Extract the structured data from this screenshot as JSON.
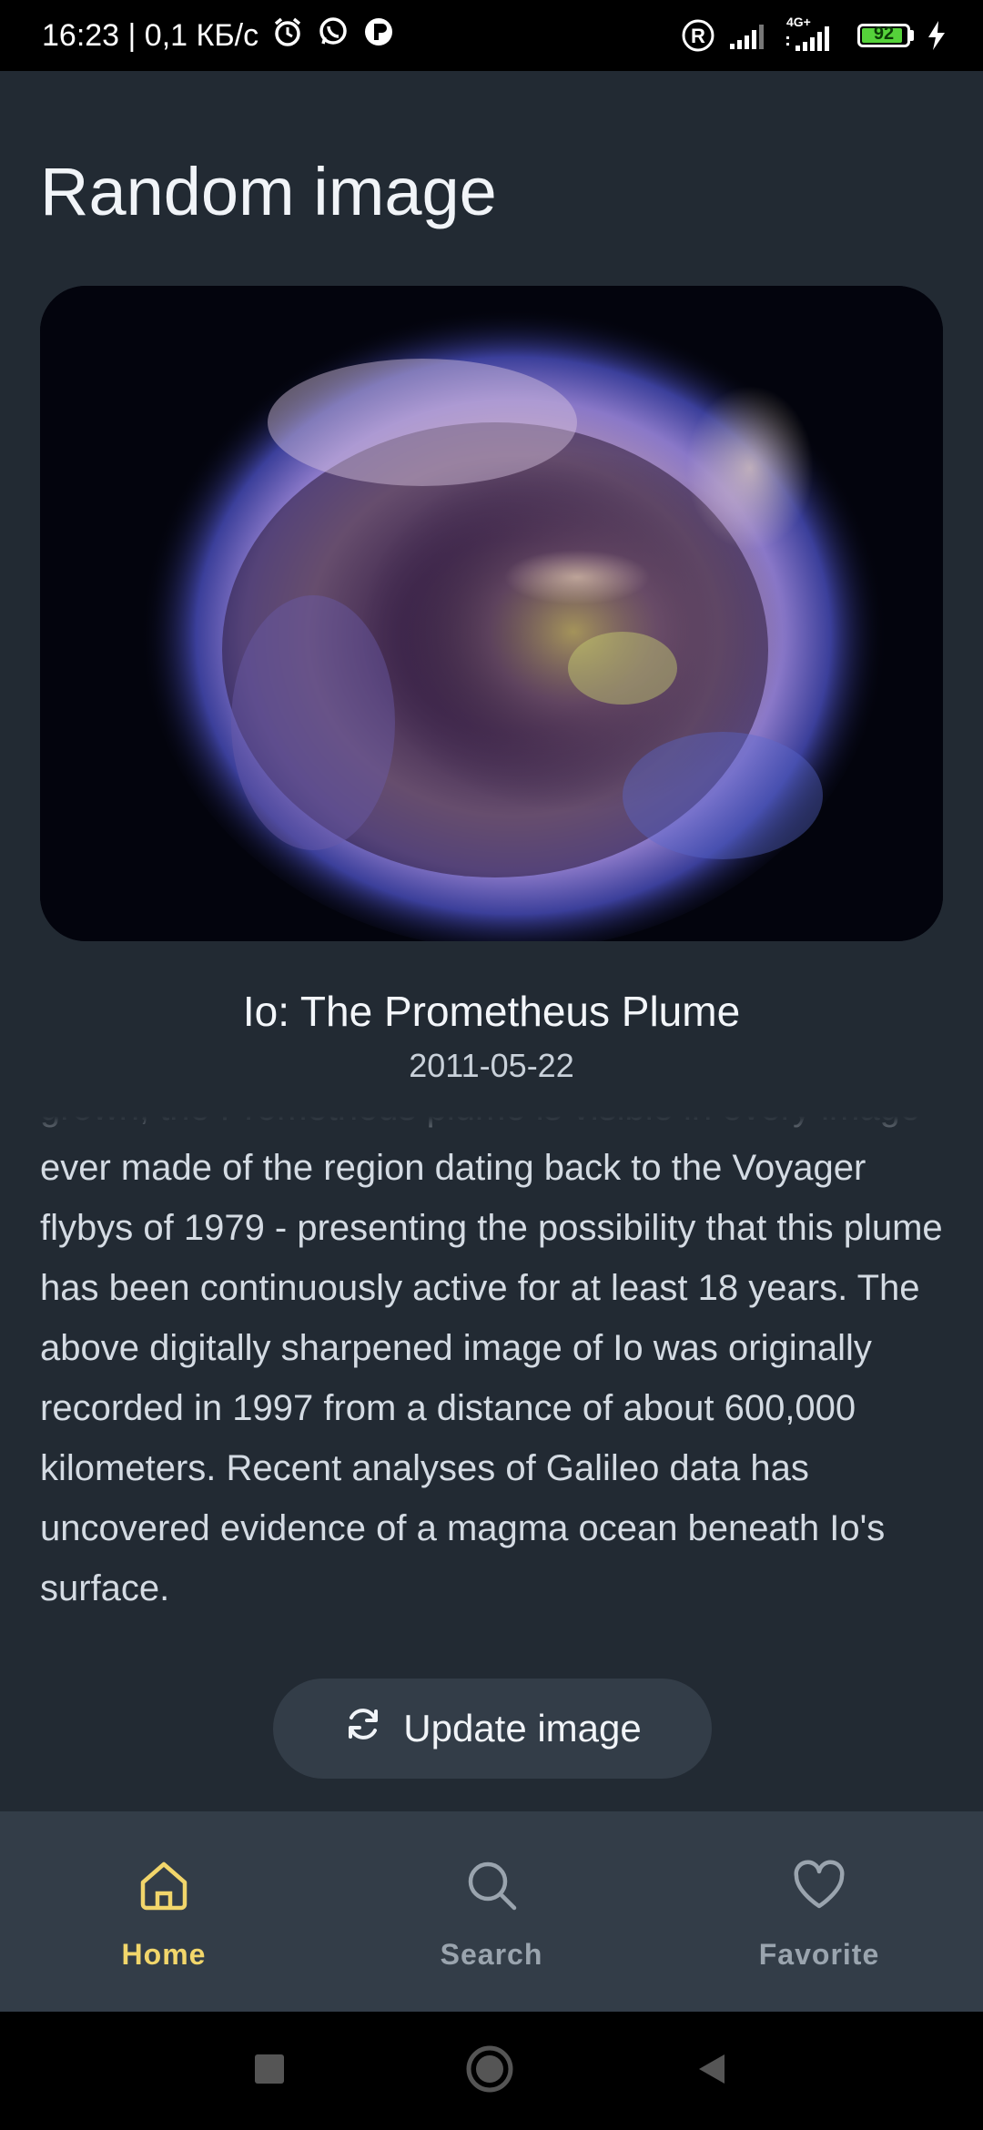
{
  "status_bar": {
    "time_speed": "16:23 | 0,1 КБ/с",
    "network_label": "4G+",
    "battery": "92",
    "battery_level": 0.92
  },
  "page": {
    "title": "Random image"
  },
  "image": {
    "title": "Io: The Prometheus Plume",
    "date": "2011-05-22",
    "description": "grown, the Prometheus plume is visible in every image ever made of the region dating back to the Voyager flybys of 1979 - presenting the possibility that this plume has been continuously active for at least 18 years. The above digitally sharpened image of Io was originally recorded in 1997 from a distance of about 600,000 kilometers. Recent analyses of Galileo data has uncovered evidence of a magma ocean beneath Io's surface."
  },
  "update_button": {
    "label": "Update image",
    "icon": "refresh-icon"
  },
  "bottom_nav": {
    "items": [
      {
        "label": "Home",
        "icon": "home-icon",
        "active": true
      },
      {
        "label": "Search",
        "icon": "search-icon",
        "active": false
      },
      {
        "label": "Favorite",
        "icon": "heart-icon",
        "active": false
      }
    ]
  },
  "colors": {
    "background": "#222a33",
    "surface": "#333d48",
    "accent": "#f2d66b",
    "inactive": "#9aa4ae"
  }
}
